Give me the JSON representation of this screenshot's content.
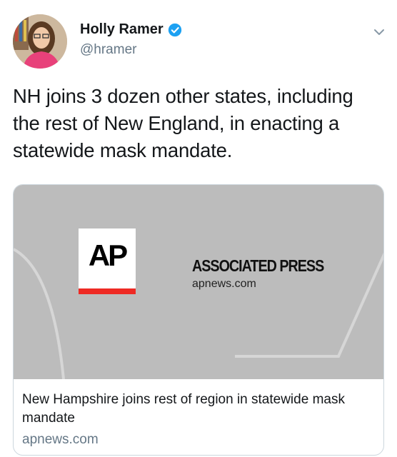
{
  "author": {
    "name": "Holly Ramer",
    "handle": "@hramer"
  },
  "tweet": {
    "text": "NH joins 3 dozen other states, including the rest of New England, in enacting a statewide mask mandate."
  },
  "card": {
    "image": {
      "logo_text": "AP",
      "publisher_name": "ASSOCIATED PRESS",
      "publisher_domain": "apnews.com"
    },
    "title": "New Hampshire joins rest of region in statewide mask mandate",
    "domain": "apnews.com"
  },
  "colors": {
    "verified_badge": "#1da1f2",
    "ap_red": "#ee2a24",
    "card_image_bg": "#bcbcbc",
    "secondary_text": "#657786"
  },
  "icons": {
    "verified": "verified-badge-icon",
    "menu": "chevron-down-icon"
  }
}
